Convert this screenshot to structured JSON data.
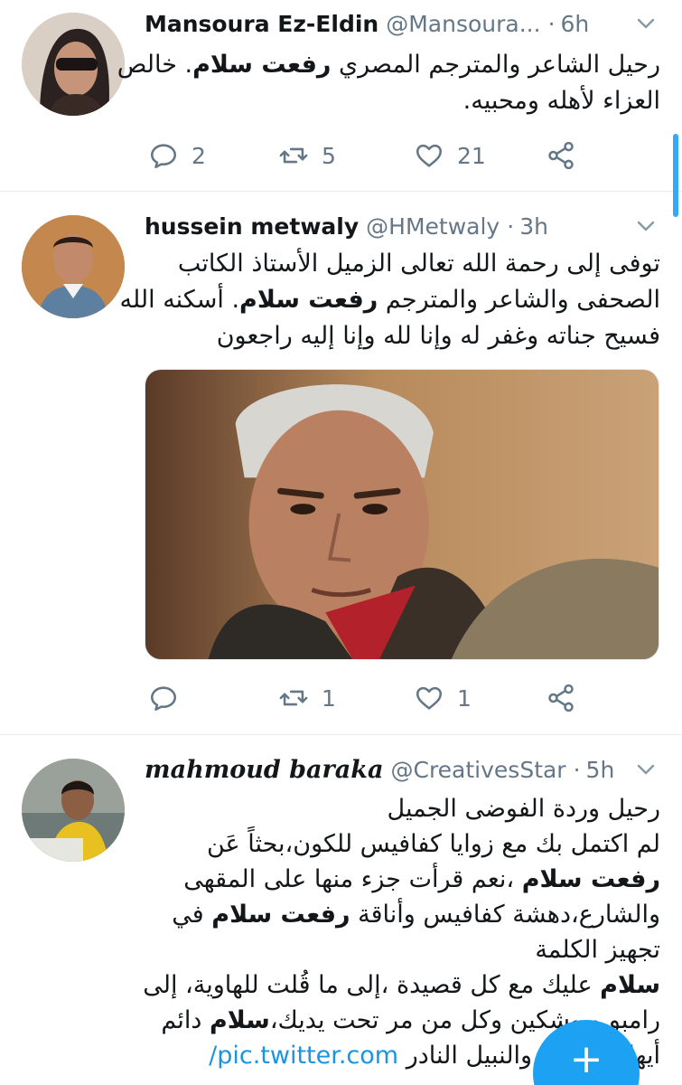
{
  "colors": {
    "accent": "#1da1f2",
    "link": "#1b95e0",
    "muted": "#657786",
    "text": "#14171a",
    "divider": "#e6ecf0"
  },
  "tweets": [
    {
      "name": "Mansoura Ez-Eldin",
      "handle": "@Mansoura...",
      "sep": "·",
      "time": "6h",
      "lines": [
        {
          "pre": "رحيل الشاعر والمترجم المصري ",
          "bold": "رفعت سلام",
          "post": ". خالص"
        },
        {
          "pre": "العزاء لأهله ومحبيه.",
          "bold": "",
          "post": ""
        }
      ],
      "reply_count": "2",
      "retweet_count": "5",
      "like_count": "21"
    },
    {
      "name": "hussein metwaly",
      "handle": "@HMetwaly",
      "sep": "·",
      "time": "3h",
      "lines": [
        {
          "pre": "توفى إلى رحمة الله تعالى الزميل الأستاذ الكاتب",
          "bold": "",
          "post": ""
        },
        {
          "pre": "الصحفى والشاعر والمترجم ",
          "bold": "رفعت سلام",
          "post": ". أسكنه الله"
        },
        {
          "pre": "فسيح جناته وغفر له وإنا لله وإنا إليه راجعون",
          "bold": "",
          "post": ""
        }
      ],
      "reply_count": "",
      "retweet_count": "1",
      "like_count": "1"
    },
    {
      "name": "mahmoud baraka",
      "handle": "@CreativesStar",
      "sep": "·",
      "time": "5h",
      "lines": [
        {
          "pre": "رحيل وردة الفوضى الجميل",
          "bold": "",
          "post": ""
        },
        {
          "pre": "لم اكتمل بك مع زوايا كفافيس للكون،بحثاً عَن",
          "bold": "",
          "post": ""
        },
        {
          "pre": "",
          "bold": "رفعت سلام",
          "post": " ،نعم قرأت جزء منها على المقهى"
        },
        {
          "pre": "والشارع،دهشة كفافيس وأناقة ",
          "bold": "رفعت سلام",
          "post": " في"
        },
        {
          "pre": "تجهيز الكلمة",
          "bold": "",
          "post": ""
        },
        {
          "pre": "",
          "bold": "سلام",
          "post": " عليك مع كل قصيدة ،إلى ما قُلت للهاوية، إلى"
        },
        {
          "pre": "رامبو وبوشكين وكل من مر تحت يديك،",
          "bold": "سلام",
          "post": " دائم"
        },
        {
          "pre": "أيها المترجم والنبيل النادر ",
          "bold": "",
          "post": ""
        }
      ],
      "link": "pic.twitter.com/"
    }
  ]
}
